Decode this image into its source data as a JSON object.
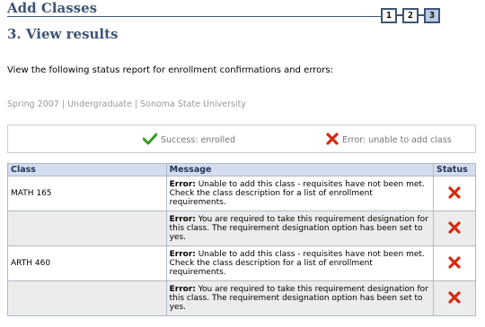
{
  "header": {
    "title": "Add Classes",
    "subtitle": "3. View results",
    "steps": [
      "1",
      "2",
      "3"
    ],
    "active_step": 3
  },
  "intro_text": "View the following status report for enrollment confirmations and errors:",
  "term_info": "Spring 2007 | Undergraduate | Sonoma State University",
  "legend": {
    "success_label": "Success: enrolled",
    "error_label": "Error: unable to add class",
    "success_icon": "checkmark-icon",
    "error_icon": "x-icon",
    "success_color": "#3a9a1e",
    "error_color": "#d32a10"
  },
  "table": {
    "headers": {
      "class": "Class",
      "message": "Message",
      "status": "Status"
    },
    "rows": [
      {
        "class": "MATH  165",
        "error_label": "Error:",
        "message": " Unable to add this class - requisites have not been met. Check the class description for a list of enrollment requirements.",
        "status": "error"
      },
      {
        "class": "",
        "error_label": "Error:",
        "message": " You are required to take this requirement designation for this class. The requirement designation option has been set to yes.",
        "status": "error"
      },
      {
        "class": "ARTH  460",
        "error_label": "Error:",
        "message": " Unable to add this class - requisites have not been met. Check the class description for a list of enrollment requirements.",
        "status": "error"
      },
      {
        "class": "",
        "error_label": "Error:",
        "message": " You are required to take this requirement designation for this class. The requirement designation option has been set to yes.",
        "status": "error"
      }
    ]
  }
}
